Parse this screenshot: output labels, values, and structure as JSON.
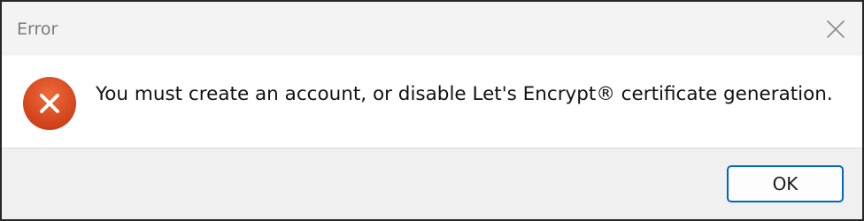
{
  "window": {
    "title": "Error",
    "close_icon": "close-icon"
  },
  "content": {
    "icon": "error-icon",
    "message": "You must create an account, or disable Let's Encrypt® certificate generation."
  },
  "buttons": {
    "ok_label": "OK"
  },
  "colors": {
    "titlebar_bg": "#f3f3f3",
    "footer_bg": "#f0f0f0",
    "error_red": "#d8471f",
    "button_focus_border": "#0067c0"
  }
}
